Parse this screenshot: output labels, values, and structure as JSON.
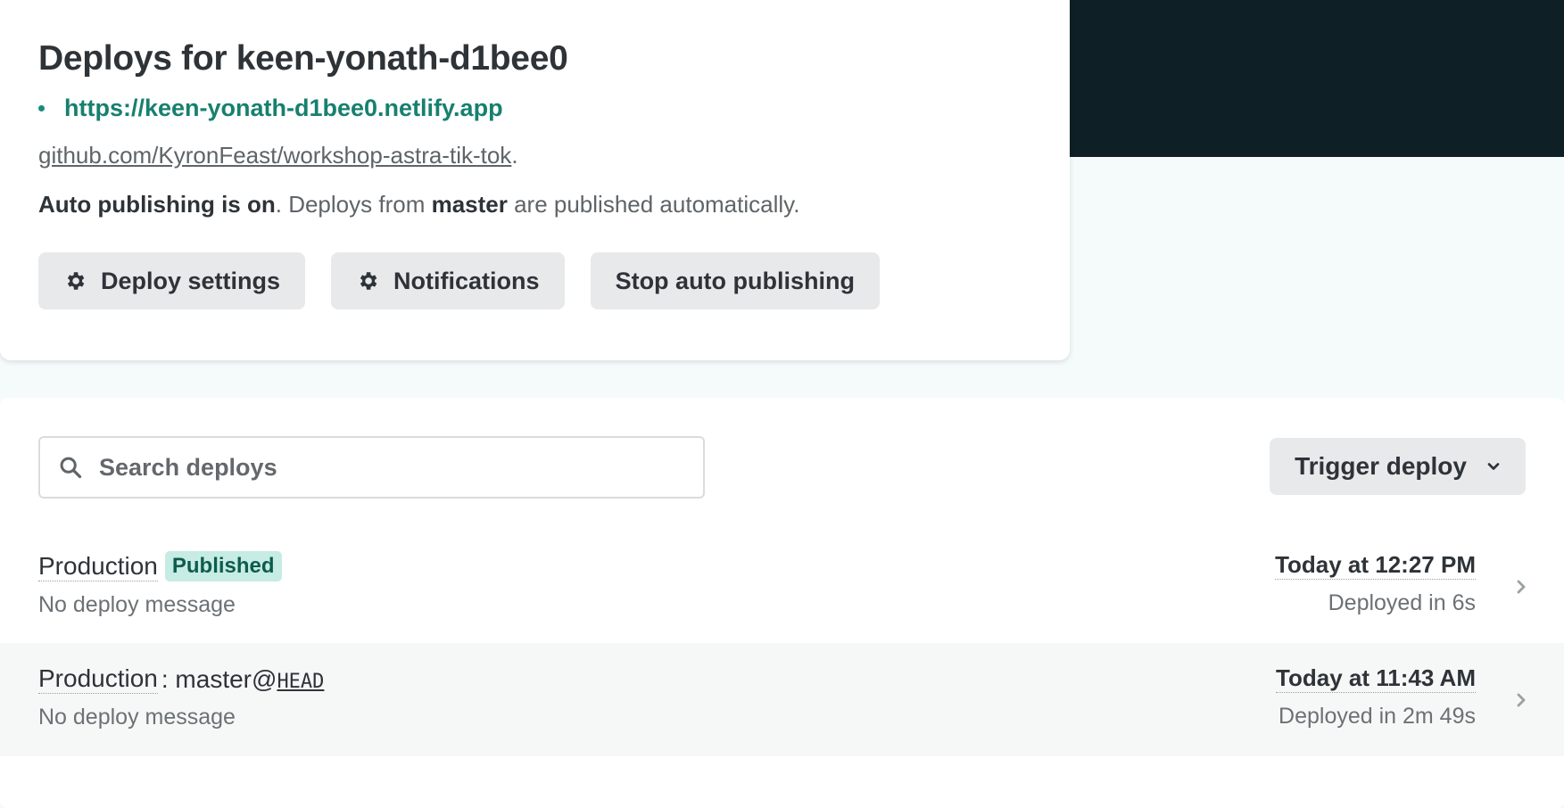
{
  "site": {
    "title": "Deploys for keen-yonath-d1bee0",
    "url": "https://keen-yonath-d1bee0.netlify.app",
    "repo": "github.com/KyronFeast/workshop-astra-tik-tok",
    "repo_suffix": ".",
    "autopub_bold": "Auto publishing is on",
    "autopub_text_1": ". Deploys from ",
    "autopub_branch": "master",
    "autopub_text_2": " are published automatically.",
    "buttons": {
      "deploy_settings": "Deploy settings",
      "notifications": "Notifications",
      "stop_auto_publishing": "Stop auto publishing"
    }
  },
  "deploys": {
    "search_placeholder": "Search deploys",
    "trigger_label": "Trigger deploy",
    "rows": [
      {
        "context": "Production",
        "badge": "Published",
        "message": "No deploy message",
        "time": "Today at 12:27 PM",
        "duration": "Deployed in 6s"
      },
      {
        "context": "Production",
        "branch_prefix": ": master@",
        "commit": "HEAD",
        "message": "No deploy message",
        "time": "Today at 11:43 AM",
        "duration": "Deployed in 2m 49s"
      }
    ]
  },
  "colors": {
    "header_dark": "#0f1f26",
    "link_teal": "#17806f",
    "badge_bg": "#c6ece4",
    "badge_text": "#0d5c4e",
    "button_bg": "#e8e9eb"
  }
}
